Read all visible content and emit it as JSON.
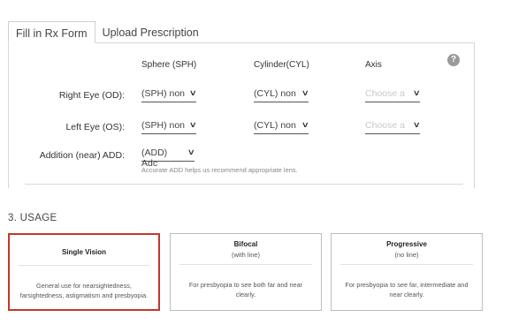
{
  "tabs": [
    {
      "label": "Fill in Rx Form",
      "active": true
    },
    {
      "label": "Upload Prescription",
      "active": false
    }
  ],
  "rx_form": {
    "headers": {
      "sphere": "Sphere (SPH)",
      "cylinder": "Cylinder(CYL)",
      "axis": "Axis"
    },
    "help": "?",
    "rows": [
      {
        "label": "Right Eye (OD):",
        "sph": "(SPH) non",
        "cyl": "(CYL) non",
        "axis": "Choose a"
      },
      {
        "label": "Left Eye (OS):",
        "sph": "(SPH) non",
        "cyl": "(CYL) non",
        "axis": "Choose a"
      }
    ],
    "add": {
      "label": "Addition (near) ADD:",
      "value": "(ADD) Adc",
      "note": "Accurate ADD helps us recommend appropriate lens."
    }
  },
  "usage": {
    "title": "3. USAGE",
    "options": [
      {
        "title": "Single Vision",
        "subtitle": "",
        "description": "General use for nearsightedness, farsightedness, astigmatism and presbyopia.",
        "selected": true
      },
      {
        "title": "Bifocal",
        "subtitle": "(with line)",
        "description": "For presbyopia to see both far and near clearly.",
        "selected": false
      },
      {
        "title": "Progressive",
        "subtitle": "(no line)",
        "description": "For presbyopia to see far, intermediate and near clearly.",
        "selected": false
      }
    ]
  },
  "colors": {
    "selected_border": "#c0392b"
  },
  "icons": {
    "dropdown": "chevron-down-icon",
    "help": "question-circle-icon"
  }
}
